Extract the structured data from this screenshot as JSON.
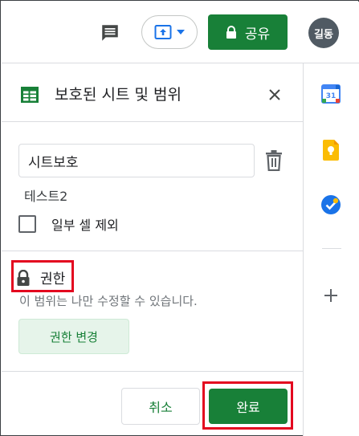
{
  "topbar": {
    "share_label": "공유",
    "avatar_initials": "길동"
  },
  "panel": {
    "title": "보호된 시트 및 범위",
    "description_value": "시트보호",
    "range_label": "테스트2",
    "exclude_cells_label": "일부 셀 제외",
    "permissions_title": "권한",
    "permissions_description": "이 범위는 나만 수정할 수 있습니다.",
    "change_permissions_label": "권한 변경",
    "cancel_label": "취소",
    "done_label": "완료"
  },
  "sidebar": {
    "calendar_date": "31"
  },
  "colors": {
    "primary_green": "#188038",
    "light_green": "#e6f4ea",
    "highlight_red": "#e3071f"
  },
  "icons": [
    "comment-icon",
    "present-icon",
    "lock-icon",
    "sheets-icon",
    "close-icon",
    "trash-icon",
    "calendar-icon",
    "keep-icon",
    "tasks-icon",
    "plus-icon"
  ]
}
